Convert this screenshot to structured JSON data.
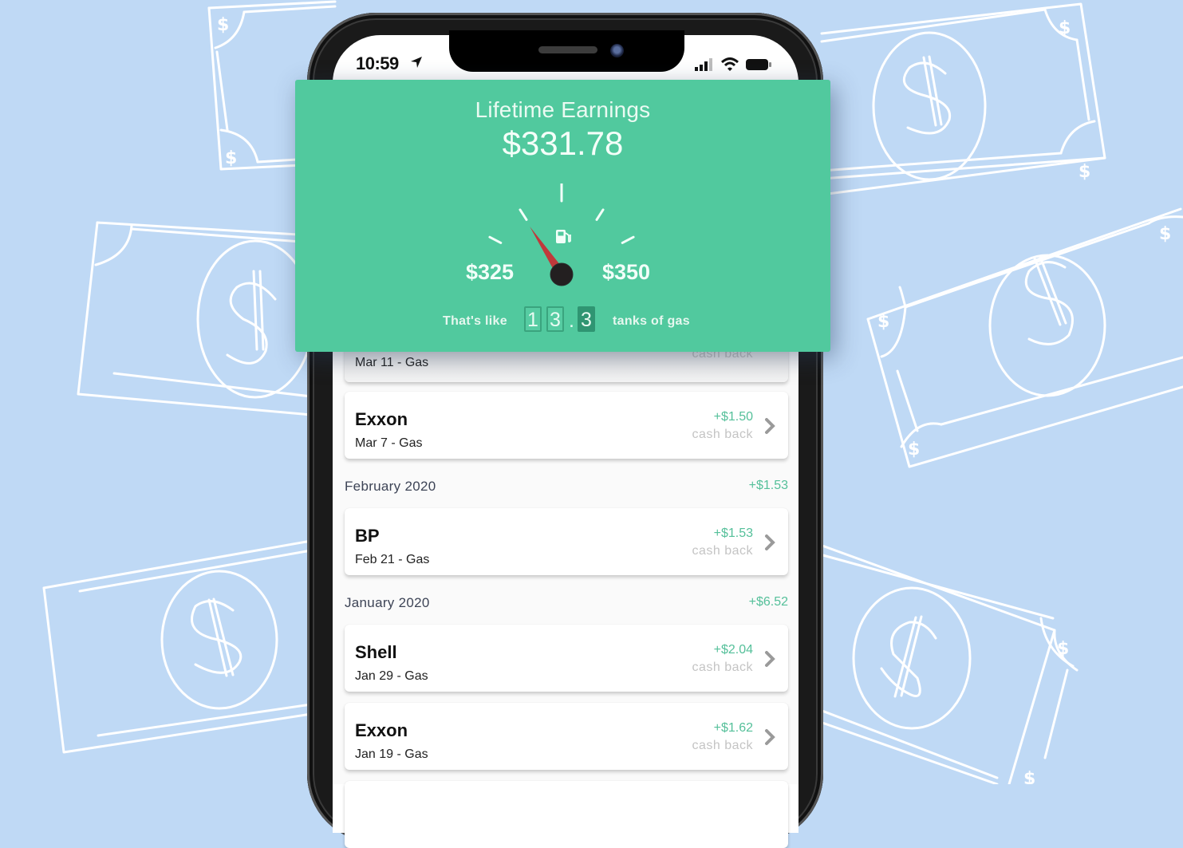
{
  "status_bar": {
    "time": "10:59",
    "location_icon": "location-arrow-icon",
    "signal_icon": "cellular-signal-icon",
    "wifi_icon": "wifi-icon",
    "battery_icon": "battery-icon"
  },
  "earnings": {
    "title": "Lifetime Earnings",
    "amount": "$331.78",
    "gauge": {
      "min_label": "$325",
      "max_label": "$350",
      "min_value": 325,
      "max_value": 350,
      "current_value": 331.78,
      "icon": "gas-pump-icon"
    },
    "tanks": {
      "prefix": "That's like",
      "digits": [
        "1",
        "3",
        "3"
      ],
      "decimal": ".",
      "value": "13.3",
      "suffix": "tanks of gas"
    },
    "colors": {
      "card": "#51c99e",
      "needle": "#c0393b",
      "positive": "#55c09a"
    }
  },
  "transactions": {
    "partial_top": {
      "sub": "Mar 11 - Gas",
      "cashback_label": "cash back"
    },
    "groups": [
      {
        "month": "",
        "total": "",
        "items": [
          {
            "merchant": "Exxon",
            "sub": "Mar 7 - Gas",
            "amount": "+$1.50",
            "cashback_label": "cash back"
          }
        ]
      },
      {
        "month": "February 2020",
        "total": "+$1.53",
        "items": [
          {
            "merchant": "BP",
            "sub": "Feb 21 - Gas",
            "amount": "+$1.53",
            "cashback_label": "cash back"
          }
        ]
      },
      {
        "month": "January 2020",
        "total": "+$6.52",
        "items": [
          {
            "merchant": "Shell",
            "sub": "Jan 29 - Gas",
            "amount": "+$2.04",
            "cashback_label": "cash back"
          },
          {
            "merchant": "Exxon",
            "sub": "Jan 19 - Gas",
            "amount": "+$1.62",
            "cashback_label": "cash back"
          }
        ]
      }
    ]
  }
}
